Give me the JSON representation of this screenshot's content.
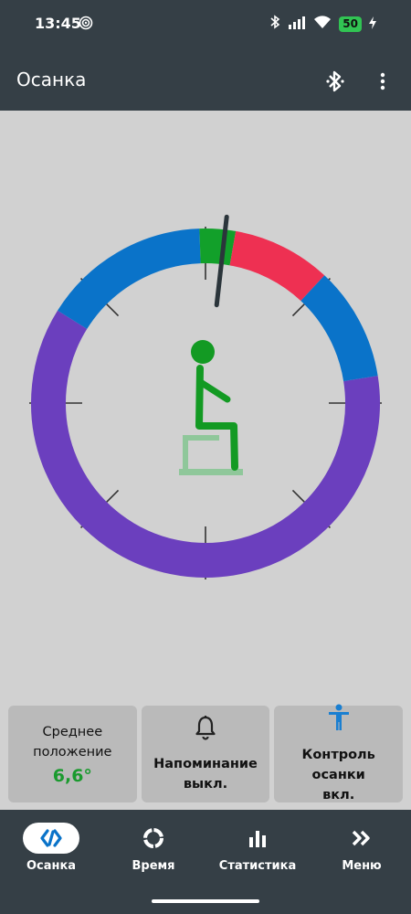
{
  "status_bar": {
    "time": "13:45",
    "battery": "50"
  },
  "app_bar": {
    "title": "Осанка"
  },
  "cards": {
    "average": {
      "label_line1": "Среднее",
      "label_line2": "положение",
      "value": "6,6°"
    },
    "reminder": {
      "label_line1": "Напоминание",
      "label_line2": "выкл."
    },
    "control": {
      "label_line1": "Контроль осанки",
      "label_line2": "вкл."
    }
  },
  "nav": {
    "posture": "Осанка",
    "time": "Время",
    "stats": "Статистика",
    "menu": "Меню"
  },
  "colors": {
    "bar_bg": "#353f46",
    "purple": "#6b3fbe",
    "blue": "#0a73c9",
    "green": "#12a02a",
    "red": "#ee3052",
    "figure": "#139a23"
  }
}
